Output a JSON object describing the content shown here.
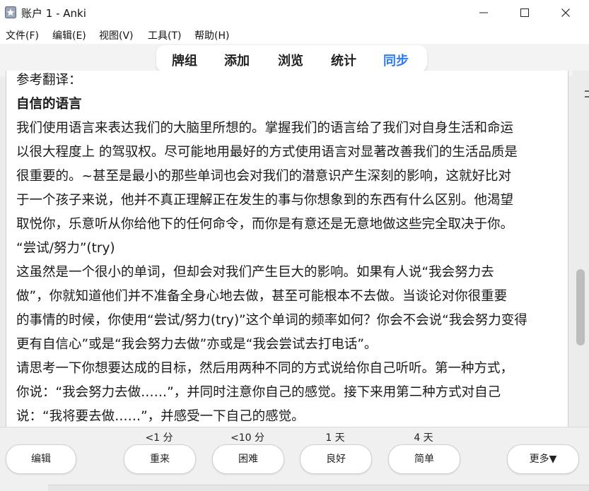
{
  "window": {
    "title": "账户 1 - Anki",
    "app_icon": "anki-star-icon"
  },
  "menu": [
    "文件(F)",
    "编辑(E)",
    "视图(V)",
    "工具(T)",
    "帮助(H)"
  ],
  "toolbar": {
    "items": [
      "牌组",
      "添加",
      "浏览",
      "统计",
      "同步"
    ],
    "active": "同步",
    "accent": "#2d7df0"
  },
  "card": {
    "lines": [
      "参考翻译：",
      "自信的语言",
      "我们使用语言来表达我们的大脑里所想的。掌握我们的语言给了我们对自身生活和命运",
      "以很大程度上 的驾驭权。尽可能地用最好的方式使用语言对显著改善我们的生活品质是",
      "很重要的。~甚至是最小的那些单词也会对我们的潜意识产生深刻的影响，这就好比对",
      "于一个孩子来说，他并不真正理解正在发生的事与你想象到的东西有什么区别。他渴望",
      "取悦你，乐意听从你给他下的任何命令，而你是有意还是无意地做这些完全取决于你。",
      "“尝试/努力”(try)",
      "这虽然是一个很小的单词，但却会对我们产生巨大的影响。如果有人说“我会努力去",
      "做”，你就知道他们并不准备全身心地去做，甚至可能根本不去做。当谈论对你很重要",
      "的事情的时候，你使用“尝试/努力(try)”这个单词的频率如何？你会不会说“我会努力变得",
      "更有自信心”或是“我会努力去做”亦或是“我会尝试去打电话”。",
      "请思考一下你想要达成的目标，然后用两种不同的方式说给你自己听听。第一种方式，",
      "你说：“我会努力去做……”，并同时注意你自己的感觉。接下来用第二种方式对自己",
      "说：“我将要去做……”，并感受一下自己的感觉。"
    ]
  },
  "answer_bar": {
    "edit_label": "编辑",
    "buttons": [
      {
        "label": "重来",
        "interval": "<1 分"
      },
      {
        "label": "困难",
        "interval": "<10 分"
      },
      {
        "label": "良好",
        "interval": "1 天"
      },
      {
        "label": "简单",
        "interval": "4 天"
      }
    ],
    "more_label": "更多▼"
  }
}
